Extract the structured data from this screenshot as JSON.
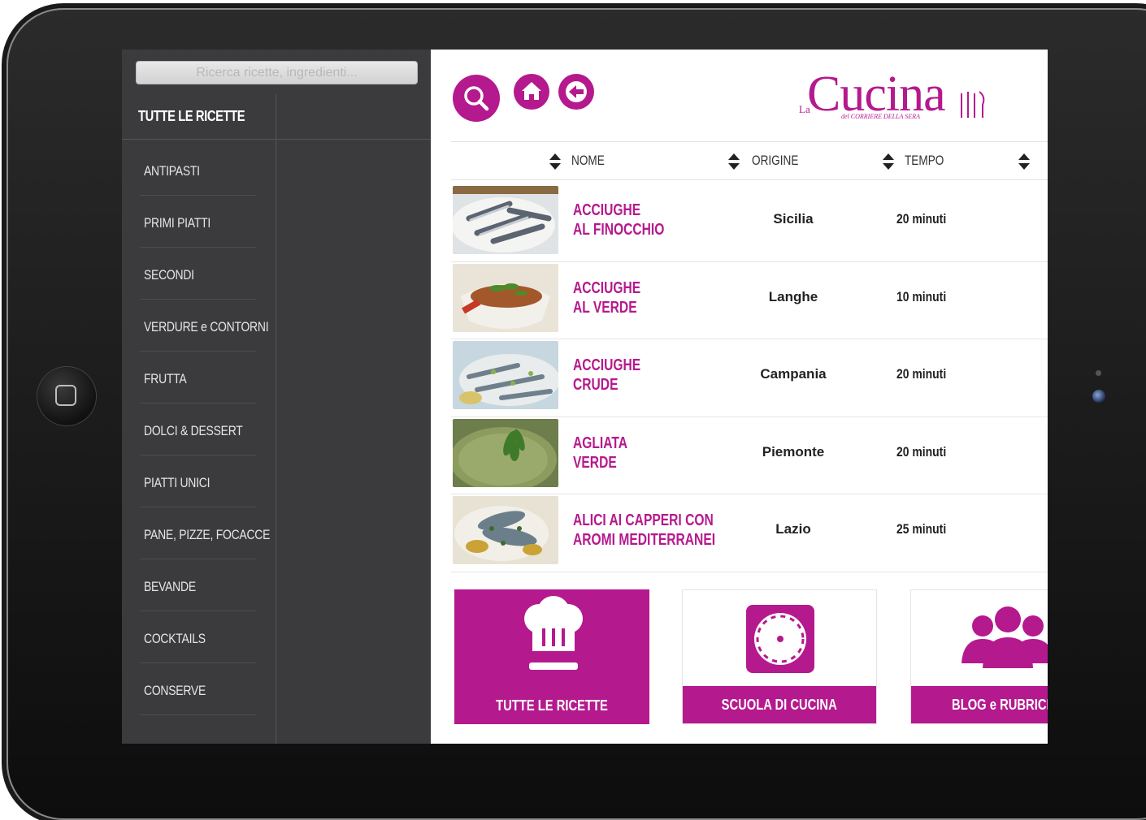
{
  "search": {
    "placeholder": "Ricerca ricette, ingredienti..."
  },
  "sidebar": {
    "all_label": "TUTTE LE RICETTE",
    "categories": [
      "ANTIPASTI",
      "PRIMI PIATTI",
      "SECONDI",
      "VERDURE e CONTORNI",
      "FRUTTA",
      "DOLCI & DESSERT",
      "PIATTI UNICI",
      "PANE, PIZZE, FOCACCE",
      "BEVANDE",
      "COCKTAILS",
      "CONSERVE"
    ]
  },
  "logo": {
    "prefix": "La",
    "main": "Cucina",
    "sub": "del CORRIERE DELLA SERA"
  },
  "table": {
    "headers": {
      "name": "NOME",
      "origin": "ORIGINE",
      "time": "TEMPO"
    },
    "rows": [
      {
        "name": [
          "ACCIUGHE",
          "AL FINOCCHIO"
        ],
        "origin": "Sicilia",
        "time": "20 minuti"
      },
      {
        "name": [
          "ACCIUGHE",
          "AL VERDE"
        ],
        "origin": "Langhe",
        "time": "10 minuti"
      },
      {
        "name": [
          "ACCIUGHE",
          "CRUDE"
        ],
        "origin": "Campania",
        "time": "20 minuti"
      },
      {
        "name": [
          "AGLIATA",
          "VERDE"
        ],
        "origin": "Piemonte",
        "time": "20 minuti"
      },
      {
        "name": [
          "ALICI AI CAPPERI CON",
          "AROMI MEDITERRANEI"
        ],
        "origin": "Lazio",
        "time": "25 minuti"
      }
    ]
  },
  "tiles": [
    {
      "label": "TUTTE LE RICETTE",
      "icon": "chef-hat-icon"
    },
    {
      "label": "SCUOLA DI CUCINA",
      "icon": "timer-icon"
    },
    {
      "label": "BLOG e RUBRICHE",
      "icon": "people-icon"
    }
  ],
  "colors": {
    "accent": "#b5198e",
    "sidebar": "#3b3b3d"
  }
}
